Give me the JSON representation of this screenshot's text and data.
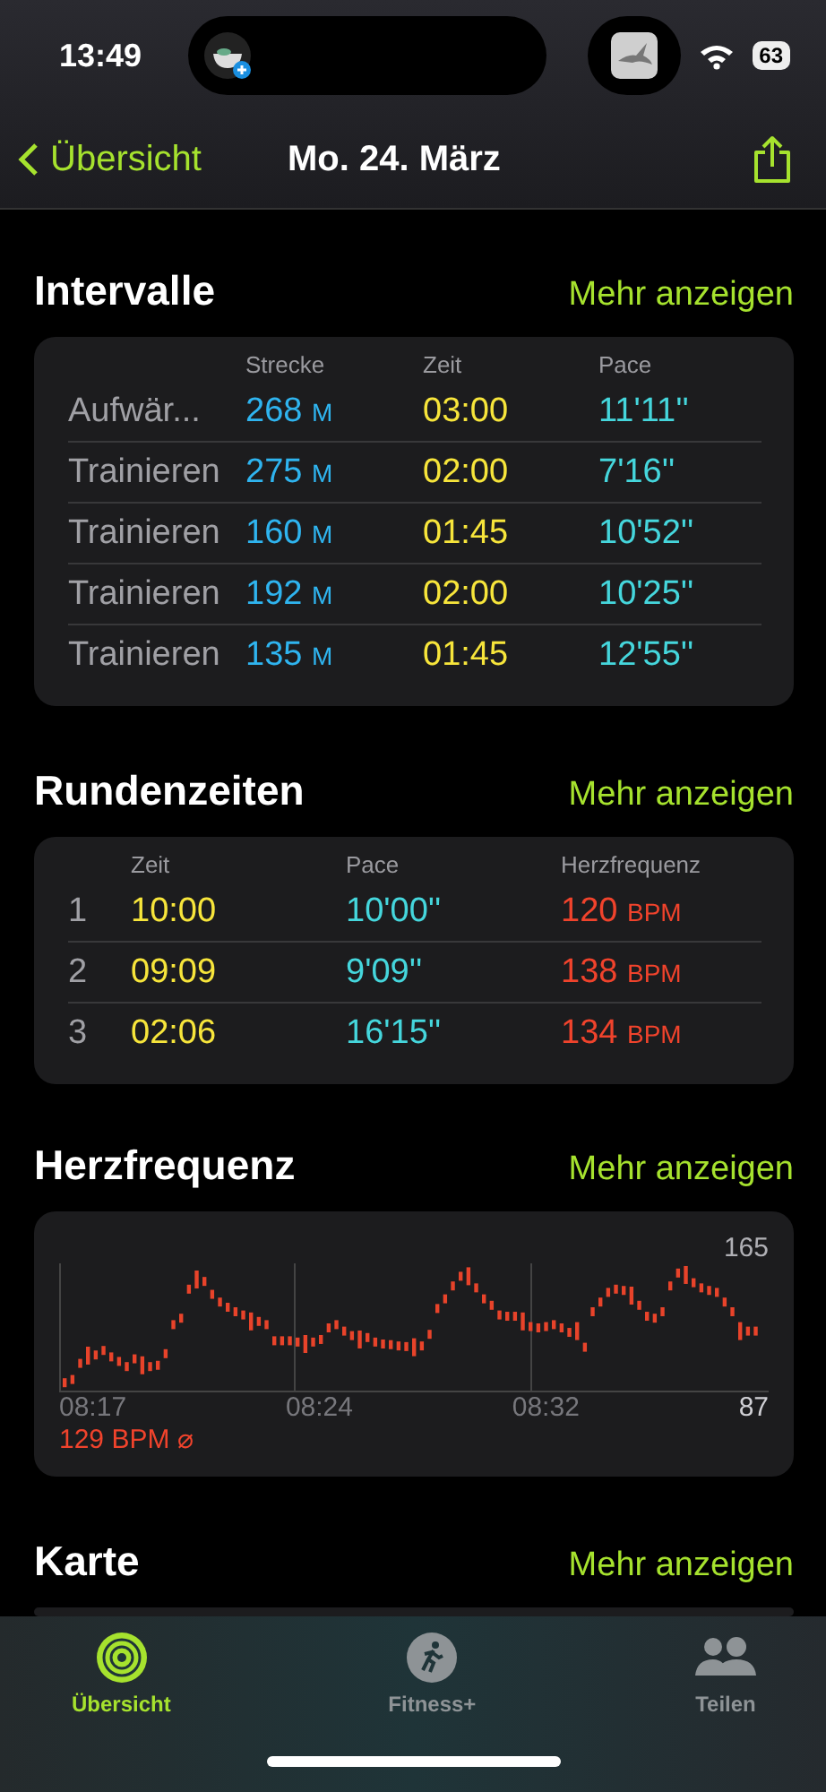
{
  "status_bar": {
    "time": "13:49",
    "battery": "63"
  },
  "nav": {
    "back": "Übersicht",
    "title": "Mo. 24. März"
  },
  "intervals": {
    "title": "Intervalle",
    "more": "Mehr anzeigen",
    "columns": [
      "Strecke",
      "Zeit",
      "Pace"
    ],
    "rows": [
      {
        "label": "Aufwär...",
        "distance": "268",
        "unit": "M",
        "time": "03:00",
        "pace": "11'11''"
      },
      {
        "label": "Trainieren",
        "distance": "275",
        "unit": "M",
        "time": "02:00",
        "pace": "7'16''"
      },
      {
        "label": "Trainieren",
        "distance": "160",
        "unit": "M",
        "time": "01:45",
        "pace": "10'52''"
      },
      {
        "label": "Trainieren",
        "distance": "192",
        "unit": "M",
        "time": "02:00",
        "pace": "10'25''"
      },
      {
        "label": "Trainieren",
        "distance": "135",
        "unit": "M",
        "time": "01:45",
        "pace": "12'55''"
      }
    ]
  },
  "laps": {
    "title": "Rundenzeiten",
    "more": "Mehr anzeigen",
    "columns": [
      "Zeit",
      "Pace",
      "Herzfrequenz"
    ],
    "rows": [
      {
        "number": "1",
        "time": "10:00",
        "pace": "10'00''",
        "heart_rate": "120",
        "unit": "BPM"
      },
      {
        "number": "2",
        "time": "09:09",
        "pace": "9'09''",
        "heart_rate": "138",
        "unit": "BPM"
      },
      {
        "number": "3",
        "time": "02:06",
        "pace": "16'15''",
        "heart_rate": "134",
        "unit": "BPM"
      }
    ]
  },
  "heart_rate": {
    "title": "Herzfrequenz",
    "more": "Mehr anzeigen",
    "max": "165",
    "min": "87",
    "x_labels": [
      "08:17",
      "08:24",
      "08:32"
    ],
    "average": "129 BPM",
    "average_mark": "⌀"
  },
  "map": {
    "title": "Karte",
    "more": "Mehr anzeigen"
  },
  "tab_bar": [
    {
      "label": "Übersicht",
      "kind": "rings",
      "selected": true
    },
    {
      "label": "Fitness+",
      "kind": "runner",
      "selected": false
    },
    {
      "label": "Teilen",
      "kind": "people",
      "selected": false
    }
  ]
}
